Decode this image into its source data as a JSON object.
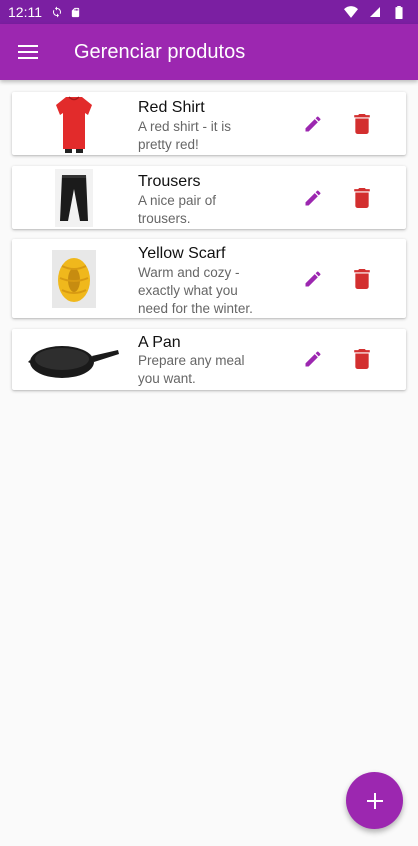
{
  "status_bar": {
    "time": "12:11",
    "icons": [
      "sync-icon",
      "sd-card-icon",
      "wifi-icon",
      "signal-icon",
      "battery-icon"
    ]
  },
  "app_bar": {
    "title": "Gerenciar produtos",
    "menu_icon": "menu-icon",
    "color": "#9c27b0"
  },
  "products": [
    {
      "title": "Red Shirt",
      "description": "A red shirt - it is pretty red!",
      "image": "red-shirt"
    },
    {
      "title": "Trousers",
      "description": "A nice pair of trousers.",
      "image": "trousers"
    },
    {
      "title": "Yellow Scarf",
      "description": "Warm and cozy - exactly what you need for the winter.",
      "image": "yellow-scarf"
    },
    {
      "title": "A Pan",
      "description": "Prepare any meal you want.",
      "image": "pan"
    }
  ],
  "actions": {
    "edit_icon": "edit-icon",
    "delete_icon": "delete-icon",
    "edit_color": "#9c27b0",
    "delete_color": "#d32f2f"
  },
  "fab": {
    "icon": "add-icon"
  }
}
